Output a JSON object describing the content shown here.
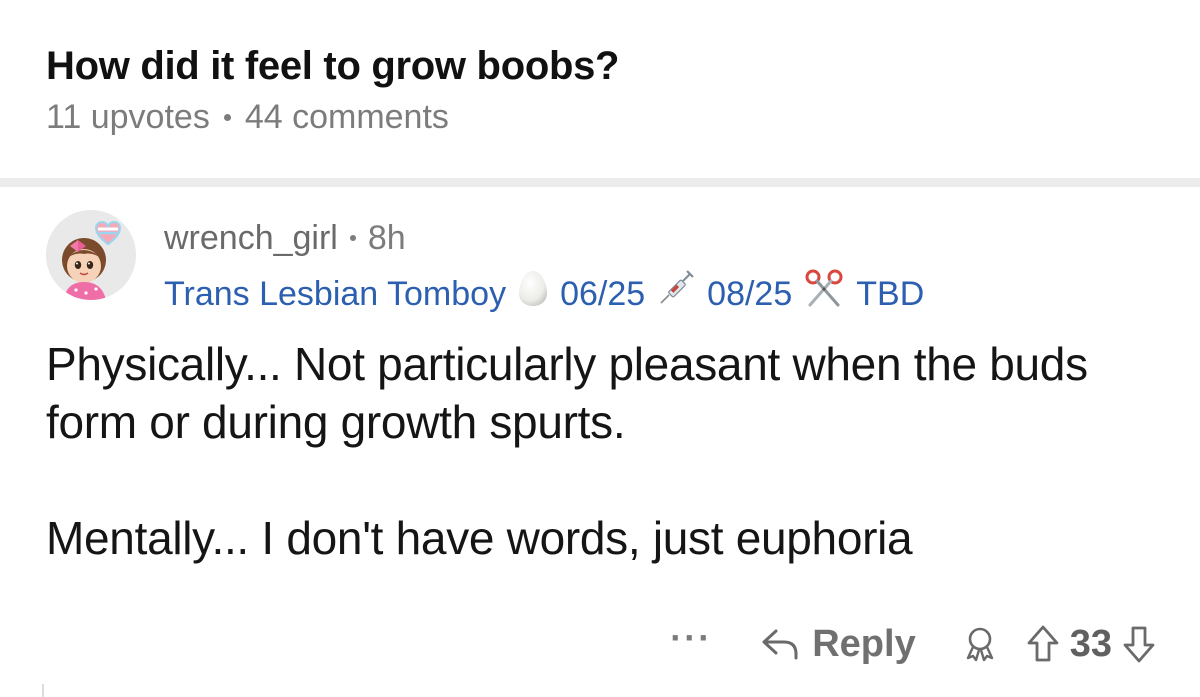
{
  "post": {
    "title": "How did it feel to grow boobs?",
    "upvotes": "11 upvotes",
    "comments": "44 comments"
  },
  "comment": {
    "author": "wrench_girl",
    "age": "8h",
    "flair": {
      "label": "Trans Lesbian Tomboy",
      "date1": "06/25",
      "date2": "08/25",
      "date3": "TBD",
      "icon1": "egg-icon",
      "icon2": "syringe-icon",
      "icon3": "scissors-icon"
    },
    "body": [
      "Physically... Not particularly pleasant when the buds form or during growth spurts.",
      "Mentally... I don't have words, just euphoria"
    ],
    "actions": {
      "more": "···",
      "reply": "Reply",
      "votes": "33"
    }
  },
  "colors": {
    "flair": "#2c5fb0",
    "meta": "#7c7c7c",
    "divider": "#ececec",
    "avatar_bg": "#e9e9ea"
  }
}
